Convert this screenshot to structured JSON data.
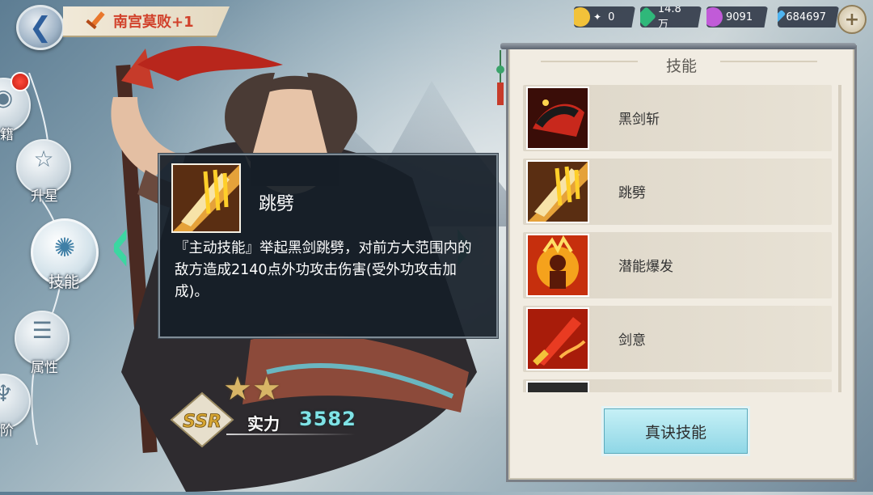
{
  "hero": {
    "name": "南宫莫败+1",
    "rarity": "SSR",
    "stars": 2,
    "power_label": "实力",
    "power_value": "3582"
  },
  "resources": [
    {
      "icon": "gold-coin-icon",
      "value": "0",
      "color": "#f2c23a"
    },
    {
      "icon": "green-gem-icon",
      "value": "14.8万",
      "color": "#2fb87a"
    },
    {
      "icon": "purple-orb-icon",
      "value": "9091",
      "color": "#c15bd8"
    },
    {
      "icon": "diamond-icon",
      "value": "684697",
      "color": "#4fb4f0"
    }
  ],
  "nav": [
    {
      "label": "籍",
      "icon": "book-icon"
    },
    {
      "label": "升星",
      "icon": "star-icon"
    },
    {
      "label": "技能",
      "icon": "skill-icon",
      "active": true
    },
    {
      "label": "属性",
      "icon": "attribute-icon"
    },
    {
      "label": "阶",
      "icon": "rank-icon"
    }
  ],
  "tooltip": {
    "skill_name": "跳劈",
    "description": "『主动技能』举起黑剑跳劈，对前方大范围内的敌方造成2140点外功攻击伤害(受外功攻击加成)。"
  },
  "panel": {
    "title": "技能",
    "skills": [
      {
        "name": "黑剑斩",
        "icon": "black-sword-slash-icon"
      },
      {
        "name": "跳劈",
        "icon": "leap-slash-icon"
      },
      {
        "name": "潜能爆发",
        "icon": "potential-burst-icon"
      },
      {
        "name": "剑意",
        "icon": "sword-intent-icon"
      }
    ],
    "true_skill_button": "真诀技能"
  },
  "colors": {
    "accent": "#3bd7a1",
    "name_red": "#d1402a",
    "power_cyan": "#7fe3e6"
  }
}
